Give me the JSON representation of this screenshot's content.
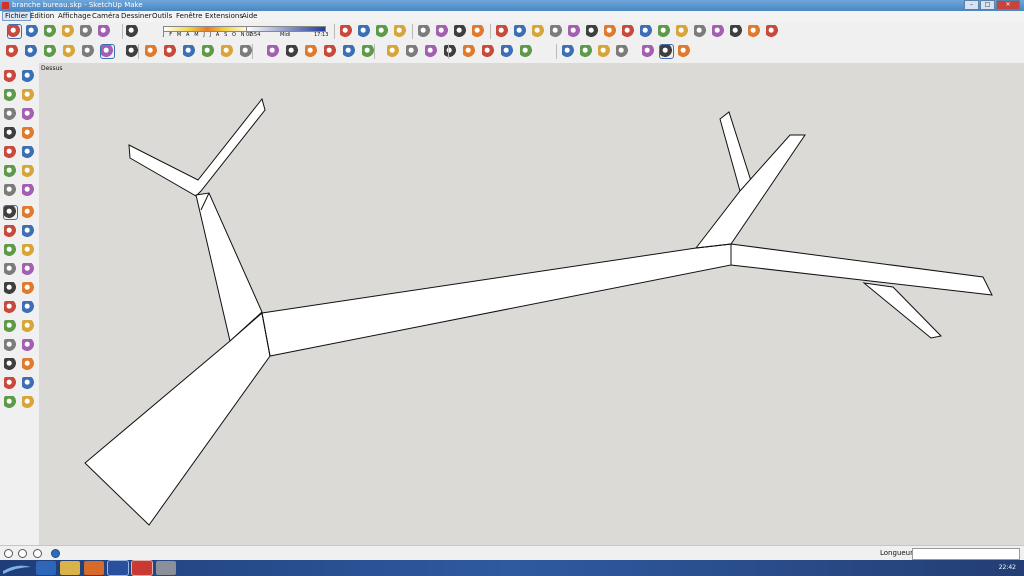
{
  "window": {
    "title": "branche bureau.skp - SketchUp Make"
  },
  "menu": [
    {
      "label": "Fichier"
    },
    {
      "label": "Édition"
    },
    {
      "label": "Affichage"
    },
    {
      "label": "Caméra"
    },
    {
      "label": "Dessiner"
    },
    {
      "label": "Outils"
    },
    {
      "label": "Fenêtre"
    },
    {
      "label": "Extensions"
    },
    {
      "label": "Aide"
    }
  ],
  "shadows": {
    "months": "J F M A M J J A S O N D",
    "time_start": "07:54",
    "time_mid": "Midi",
    "time_end": "17:13"
  },
  "viewport": {
    "scene_label": "Dessus",
    "background": "#dcdad6"
  },
  "status": {
    "measure_label": "Longueur",
    "measure_value": ""
  },
  "taskbar": {
    "clock": "22:42"
  },
  "colors": {
    "accent_red": "#d6302b",
    "selection_blue": "#3c6fb4",
    "taskbar": "#2f5aa0"
  },
  "icons": {
    "toolbar1": [
      "select-icon",
      "move-icon",
      "rotate-icon",
      "follow-me-icon",
      "scale-icon",
      "paint-bucket-icon",
      "eraser-icon",
      "shadow-widget",
      "component-icon",
      "layers-icon",
      "geo-location-icon",
      "3d-warehouse-icon",
      "materials-icon",
      "styles-icon",
      "model-info-icon",
      "outliner-icon",
      "scenes-icon",
      "sandbox-icon"
    ],
    "toolbar2": [
      "select-icon",
      "eraser-icon",
      "line-icon",
      "arc-icon",
      "shapes-icon",
      "move-icon",
      "push-pull-icon",
      "rotate-icon",
      "follow-me-icon",
      "scale-icon",
      "offset-icon",
      "tape-measure-icon",
      "text-icon",
      "axes-icon",
      "orbit-icon",
      "pan-icon",
      "zoom-icon",
      "zoom-extents-icon",
      "iso-view-icon",
      "top-view-icon",
      "front-view-icon",
      "xray-icon",
      "wireframe-icon",
      "hidden-line-icon",
      "shaded-icon",
      "textured-icon",
      "monochrome-icon"
    ],
    "left": [
      "select-icon",
      "component-icon",
      "paint-bucket-icon",
      "eraser-icon",
      "line-icon",
      "freehand-icon",
      "rectangle-icon",
      "rotated-rectangle-icon",
      "circle-icon",
      "polygon-icon",
      "arc-icon",
      "pie-icon",
      "three-point-arc-icon",
      "two-point-arc-icon",
      "move-icon",
      "push-pull-icon",
      "rotate-icon",
      "follow-me-icon",
      "scale-icon",
      "offset-icon",
      "tape-measure-icon",
      "dimension-icon",
      "protractor-icon",
      "text-icon",
      "axes-icon",
      "3d-text-icon",
      "orbit-icon",
      "pan-icon",
      "zoom-icon",
      "zoom-window-icon",
      "zoom-extents-icon",
      "previous-view-icon",
      "position-camera-icon",
      "look-around-icon",
      "walk-icon",
      "section-plane-icon"
    ],
    "status": [
      "geo-location-icon",
      "credits-icon",
      "user-icon",
      "help-icon"
    ],
    "taskbar": [
      "start-orb-icon",
      "ie-icon",
      "explorer-icon",
      "firefox-icon",
      "word-icon",
      "sketchup-icon",
      "photo-icon"
    ]
  }
}
